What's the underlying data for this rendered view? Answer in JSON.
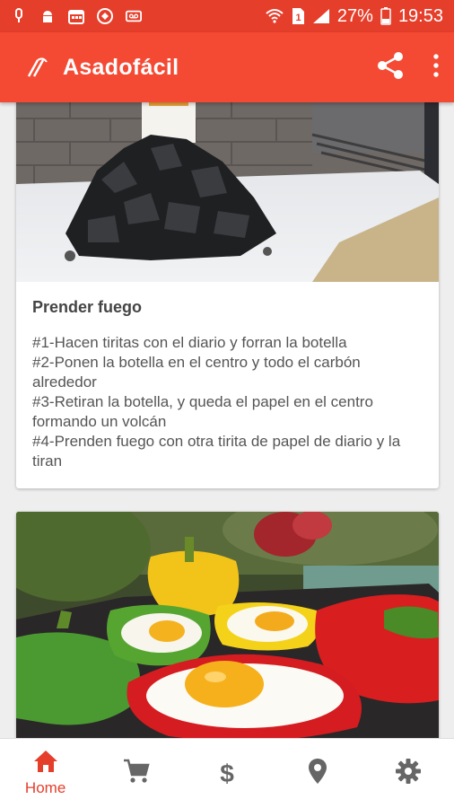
{
  "status_bar": {
    "battery_percent": "27%",
    "time": "19:53",
    "sim_label": "1",
    "icons": [
      "notification-icon",
      "android-icon",
      "calendar-icon",
      "app-icon",
      "voicemail-icon",
      "wifi-icon",
      "sim-icon",
      "signal-icon",
      "battery-icon"
    ]
  },
  "app_bar": {
    "title": "Asadofácil",
    "actions": [
      "share-icon",
      "more-vert-icon"
    ]
  },
  "cards": [
    {
      "title": "Prender fuego",
      "steps": [
        "#1-Hacen tiritas con el diario y forran la botella",
        "#2-Ponen la botella en el centro y todo el carbón alrededor",
        "#3-Retiran la botella, y queda el papel en el centro formando un volcán",
        "#4-Prenden fuego con otra tirita de papel de diario y la tiran"
      ]
    },
    {
      "title": ""
    }
  ],
  "bottom_nav": {
    "items": [
      {
        "icon": "home-icon",
        "label": "Home",
        "active": true
      },
      {
        "icon": "cart-icon",
        "label": ""
      },
      {
        "icon": "dollar-icon",
        "label": "$"
      },
      {
        "icon": "location-icon",
        "label": ""
      },
      {
        "icon": "settings-icon",
        "label": ""
      }
    ]
  },
  "colors": {
    "status_bar": "#e53e2b",
    "app_bar": "#f44a34",
    "accent": "#e53e2b"
  }
}
